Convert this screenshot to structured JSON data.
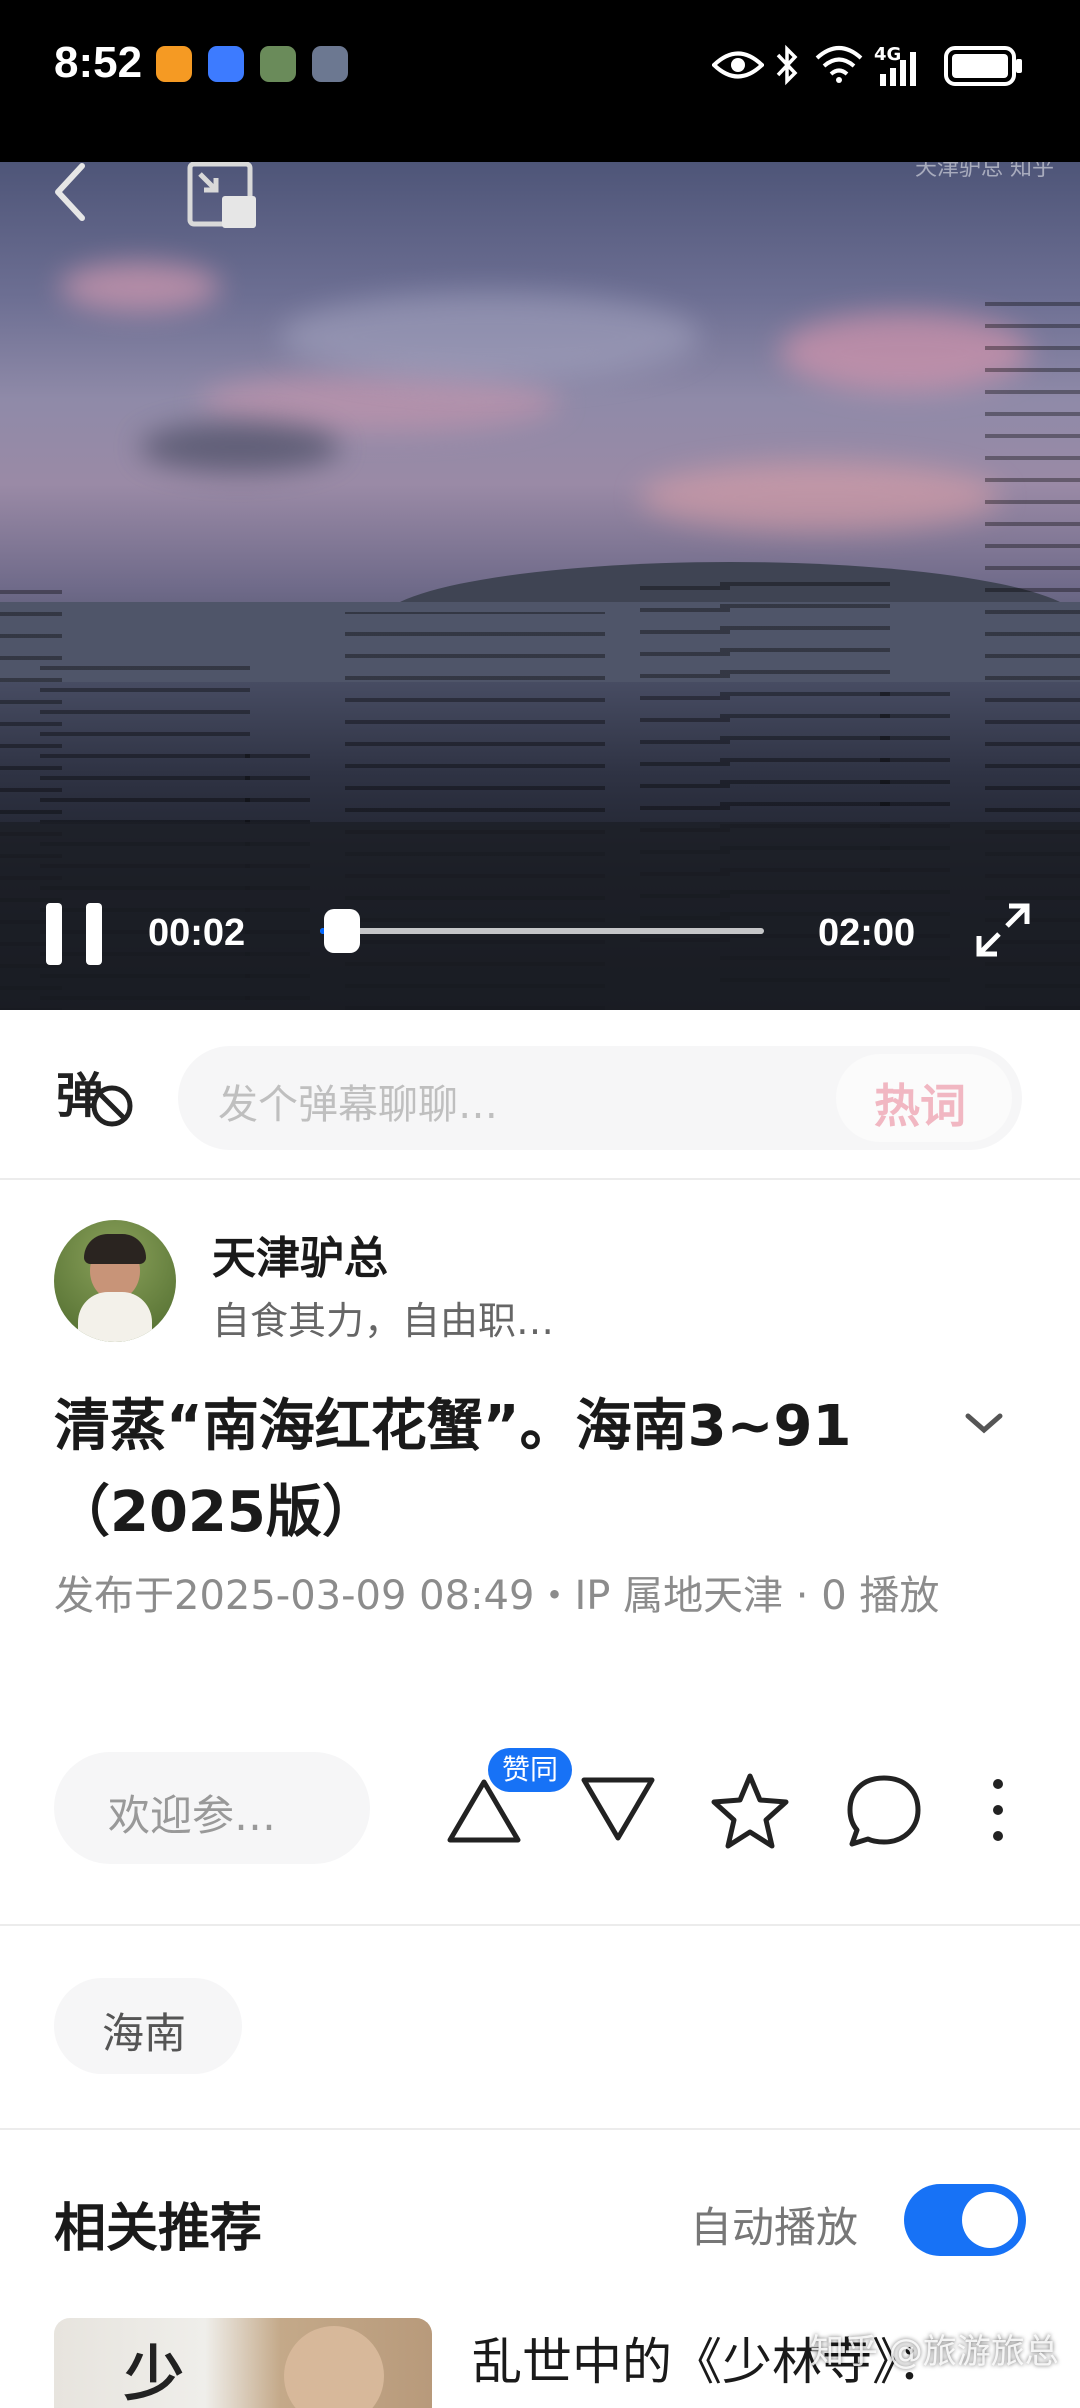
{
  "status_bar": {
    "time": "8:52",
    "network": "4G",
    "icons": [
      "eye-icon",
      "bluetooth-icon",
      "wifi-icon",
      "signal-icon",
      "battery-icon"
    ]
  },
  "video": {
    "current_time": "00:02",
    "duration": "02:00",
    "progress": 0.017,
    "watermark": "天津驴总 知乎"
  },
  "danmaku": {
    "placeholder": "发个弹幕聊聊…",
    "hot_words": "热词"
  },
  "author": {
    "name": "天津驴总",
    "bio": "自食其力，自由职…"
  },
  "post": {
    "title": "清蒸“南海红花蟹”。海南3~91（2025版）",
    "meta": "发布于2025-03-09 08:49・IP 属地天津 · 0 播放"
  },
  "actions": {
    "comment_placeholder": "欢迎参…",
    "upvote_badge": "赞同"
  },
  "tags": [
    "海南"
  ],
  "recommend": {
    "title": "相关推荐",
    "autoplay_label": "自动播放",
    "autoplay_on": true,
    "item_title": "乱世中的《少林寺》：",
    "thumb_text": "少"
  },
  "site_watermark": "知乎 @旅游旅总",
  "colors": {
    "accent": "#1772f6",
    "hot_word": "#f1b7c2"
  }
}
